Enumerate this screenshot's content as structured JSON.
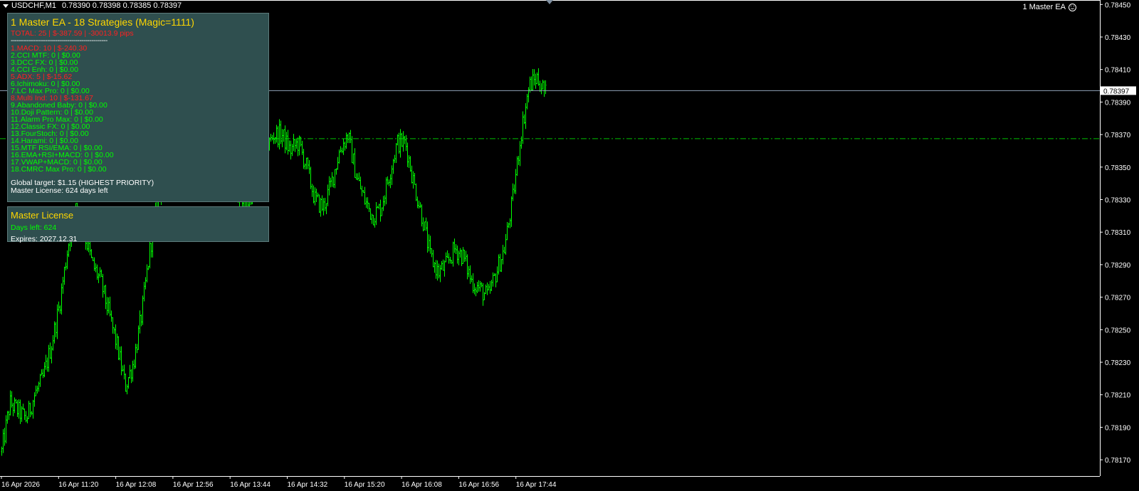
{
  "header": {
    "symbol": "USDCHF,M1",
    "ohlc": "0.78390 0.78398 0.78385 0.78397",
    "ea_name": "1 Master EA"
  },
  "ea_panel": {
    "title": "1 Master EA - 18 Strategies (Magic=1111)",
    "total": "TOTAL: 25 | $-387.59 | -30013.9 pips",
    "separator": "------------------------------------------------",
    "strategies": [
      {
        "text": "1.MACD: 10 | $-240.30",
        "color": "red"
      },
      {
        "text": "2.CCI MTF: 0 | $0.00",
        "color": "green"
      },
      {
        "text": "3.DCC FX: 0 | $0.00",
        "color": "green"
      },
      {
        "text": "4.CCI Enh: 0 | $0.00",
        "color": "green"
      },
      {
        "text": "5.ADX: 5 | $-15.62",
        "color": "red"
      },
      {
        "text": "6.Ichimoku: 0 | $0.00",
        "color": "green"
      },
      {
        "text": "7.LC Max Pro: 0 | $0.00",
        "color": "green"
      },
      {
        "text": "8.Multi Ind: 10 | $-131.67",
        "color": "red"
      },
      {
        "text": "9.Abandoned Baby: 0 | $0.00",
        "color": "green"
      },
      {
        "text": "10.Doji Pattern: 0 | $0.00",
        "color": "green"
      },
      {
        "text": "11.Alarm Pro Max: 0 | $0.00",
        "color": "green"
      },
      {
        "text": "12.Classic FX: 0 | $0.00",
        "color": "green"
      },
      {
        "text": "13.FourStoch: 0 | $0.00",
        "color": "green"
      },
      {
        "text": "14.Harami: 0 | $0.00",
        "color": "green"
      },
      {
        "text": "15.MTF RSI/EMA: 0 | $0.00",
        "color": "green"
      },
      {
        "text": "16.EMA+RSI+MACD: 0 | $0.00",
        "color": "green"
      },
      {
        "text": "17.VWAP+MACD: 0 | $0.00",
        "color": "green"
      },
      {
        "text": "18.CMRC Max Pro: 0 | $0.00",
        "color": "green"
      }
    ],
    "global_target": "Global target: $1.15 (HIGHEST PRIORITY)",
    "license_line": "Master License: 624 days left"
  },
  "license_panel": {
    "title": "Master License",
    "days_left": "Days left: 624",
    "expires": "Expires: 2027.12.31"
  },
  "colors": {
    "background": "#000000",
    "candles": "#00ff00",
    "panel_bg": "#2f4f4f",
    "title_gold": "#ffd700",
    "loss_red": "#ff2020",
    "bid_line": "#8fa3b8",
    "level_line": "#00c000"
  },
  "chart_data": {
    "type": "ohlc",
    "symbol": "USDCHF",
    "timeframe": "M1",
    "price_axis": {
      "labels": [
        "0.78450",
        "0.78430",
        "0.78410",
        "0.78390",
        "0.78370",
        "0.78350",
        "0.78330",
        "0.78310",
        "0.78290",
        "0.78270",
        "0.78250",
        "0.78230",
        "0.78210",
        "0.78190",
        "0.78170"
      ],
      "range": [
        0.7816,
        0.78451
      ]
    },
    "current_price": "0.78397",
    "level_line_price": 0.783675,
    "time_axis": {
      "labels": [
        "16 Apr 2026",
        "16 Apr 11:20",
        "16 Apr 12:08",
        "16 Apr 12:56",
        "16 Apr 13:44",
        "16 Apr 14:32",
        "16 Apr 15:20",
        "16 Apr 16:08",
        "16 Apr 16:56",
        "16 Apr 17:44"
      ]
    },
    "price_path": [
      0.78175,
      0.78205,
      0.782,
      0.78195,
      0.7821,
      0.7822,
      0.7824,
      0.78265,
      0.783,
      0.7833,
      0.7831,
      0.7829,
      0.7828,
      0.7826,
      0.7824,
      0.78215,
      0.7823,
      0.7826,
      0.783,
      0.7833,
      0.78345,
      0.7836,
      0.7837,
      0.7838,
      0.78385,
      0.7838,
      0.7837,
      0.7836,
      0.7834,
      0.7832,
      0.7833,
      0.78345,
      0.7836,
      0.7837,
      0.7837,
      0.7836,
      0.78365,
      0.7835,
      0.7833,
      0.78325,
      0.7834,
      0.7836,
      0.7837,
      0.78345,
      0.7833,
      0.7832,
      0.78325,
      0.78345,
      0.78365,
      0.78365,
      0.7834,
      0.7832,
      0.78295,
      0.78285,
      0.7829,
      0.783,
      0.78295,
      0.7828,
      0.78275,
      0.7827,
      0.78285,
      0.783,
      0.7833,
      0.7837,
      0.784,
      0.78405,
      0.78395
    ]
  }
}
